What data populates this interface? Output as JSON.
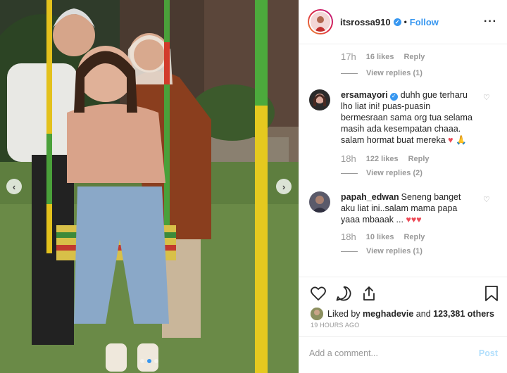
{
  "post": {
    "username": "itsrossa910",
    "follow_label": "Follow",
    "more_icon": "more-options-icon",
    "separator": "•"
  },
  "comments": [
    {
      "partial": true,
      "time": "17h",
      "likes": "16 likes",
      "reply": "Reply",
      "view_replies": "View replies (1)"
    },
    {
      "username": "ersamayori",
      "verified": true,
      "text": "duhh gue terharu lho liat ini! puas-puasin bermesraan sama org tua selama masih ada kesempatan chaaa. salam hormat buat mereka",
      "emojis": "♥ 🙏",
      "time": "18h",
      "likes": "122 likes",
      "reply": "Reply",
      "view_replies": "View replies (2)"
    },
    {
      "username": "papah_edwan",
      "text": "Seneng banget aku liat ini..salam mama papa yaaa mbaaak ...",
      "emojis": "♥♥♥",
      "time": "18h",
      "likes": "10 likes",
      "reply": "Reply",
      "view_replies": "View replies (1)"
    }
  ],
  "footer": {
    "liked_by_prefix": "Liked by",
    "liked_by_user": "meghadevie",
    "liked_by_and": "and",
    "likes_count": "123,381 others",
    "timestamp": "19 HOURS AGO",
    "comment_placeholder": "Add a comment...",
    "post_label": "Post"
  },
  "colors": {
    "accent": "#3897f0",
    "heart": "#ed4956",
    "post_disabled": "#b2dffc"
  }
}
